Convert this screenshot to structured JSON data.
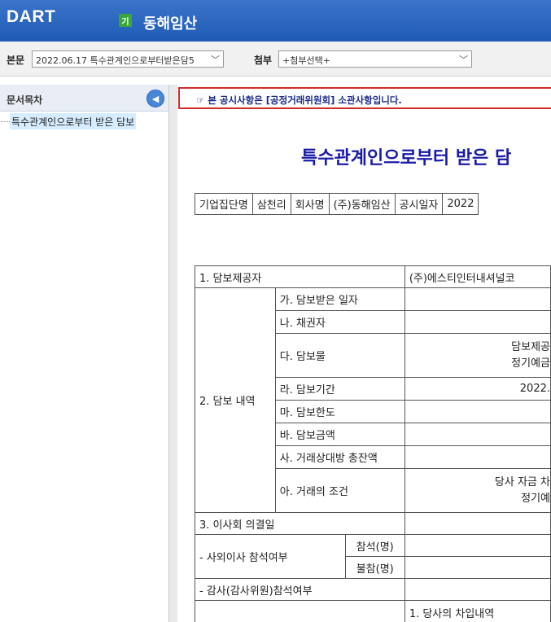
{
  "app": {
    "logo": "DART",
    "corp_badge": "기",
    "corp_name": "동해임산"
  },
  "toolbar": {
    "body_label": "본문",
    "body_value": "2022.06.17  특수관계인으로부터받은담5",
    "attach_label": "첨부",
    "attach_value": "+첨부선택+"
  },
  "sidebar": {
    "title": "문서목차",
    "items": [
      {
        "label": "특수관계인으로부터 받은 담보"
      }
    ]
  },
  "doc": {
    "notice": "☞ 본 공시사항은 [공정거래위원회] 소관사항입니다.",
    "title": "특수관계인으로부터 받은 담",
    "info_row": [
      "기업집단명",
      "삼천리",
      "회사명",
      "(주)동해임산",
      "공시일자",
      "2022"
    ],
    "rows": {
      "r1_label": "1. 담보제공자",
      "r1_value": "(주)에스티인터내셔널코",
      "r2_label": "2. 담보 내역",
      "a": "가. 담보받은 일자",
      "b": "나. 채권자",
      "c": "다. 담보물",
      "c_val1": "담보제공",
      "c_val2": "정기예금",
      "d": "라. 담보기간",
      "d_val": "2022.",
      "e": "마. 담보한도",
      "f": "바. 담보금액",
      "g": "사. 거래상대방 총잔액",
      "h": "아. 거래의 조건",
      "h_val1": "당사 자금 차",
      "h_val2": "정기예",
      "r3_label": "3. 이사회 의결일",
      "outside_label": "- 사외이사 참석여부",
      "attend": "참석(명)",
      "absent": "불참(명)",
      "audit_label": "- 감사(감사위원)참석여부",
      "last_val": "1. 당사의 차입내역"
    }
  },
  "colors": {
    "header": "#2a66c0",
    "notice_border": "#d42a2a",
    "title": "#1a1aa8"
  }
}
